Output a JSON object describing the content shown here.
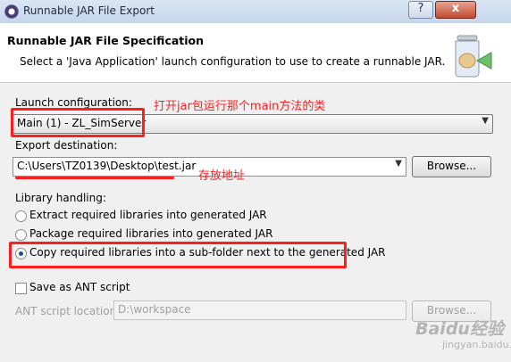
{
  "window": {
    "title": "Runnable JAR File Export",
    "help_glyph": "?",
    "close_glyph": "x"
  },
  "header": {
    "title": "Runnable JAR File Specification",
    "description": "Select a 'Java Application' launch configuration to use to create a runnable JAR."
  },
  "launch": {
    "label": "Launch configuration:",
    "value": "Main (1) - ZL_SimServer",
    "annotation": "打开jar包运行那个main方法的类"
  },
  "export": {
    "label": "Export destination:",
    "value": "C:\\Users\\TZ0139\\Desktop\\test.jar",
    "browse_label": "Browse...",
    "annotation": "存放地址"
  },
  "library": {
    "label": "Library handling:",
    "options": [
      {
        "label": "Extract required libraries into generated JAR",
        "checked": false
      },
      {
        "label": "Package required libraries into generated JAR",
        "checked": false
      },
      {
        "label": "Copy required libraries into a sub-folder next to the generated JAR",
        "checked": true
      }
    ]
  },
  "ant": {
    "checkbox_label": "Save as ANT script",
    "checked": false,
    "location_label": "ANT script location:",
    "location_value": "D:\\workspace",
    "browse_label": "Browse..."
  },
  "watermark": {
    "brand": "Baidu经验",
    "url": "jingyan.baidu.com"
  },
  "colors": {
    "annotation_red": "#ff1e1e",
    "titlebar": "#c4d6ec",
    "panel_bg": "#f0f0f0"
  }
}
